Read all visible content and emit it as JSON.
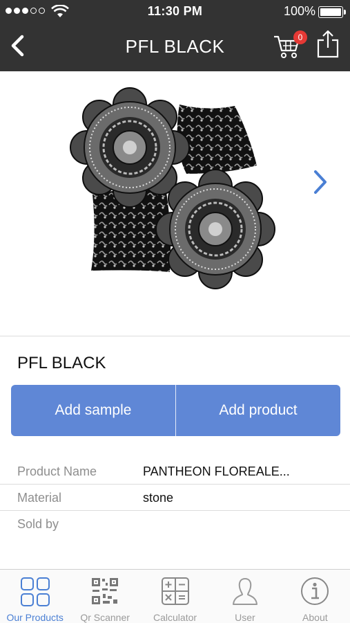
{
  "status_bar": {
    "time": "11:30 PM",
    "battery": "100%",
    "signal_bars_filled": 3,
    "signal_bars_total": 5
  },
  "nav": {
    "title": "PFL BLACK",
    "back_icon": "chevron-left-icon",
    "cart_icon": "cart-icon",
    "cart_count": "0",
    "share_icon": "share-icon"
  },
  "gallery": {
    "next_icon": "chevron-right-icon"
  },
  "product": {
    "name": "PFL BLACK",
    "add_sample_label": "Add sample",
    "add_product_label": "Add product"
  },
  "specs": [
    {
      "label": "Product Name",
      "value": "PANTHEON FLOREALE..."
    },
    {
      "label": "Material",
      "value": "stone"
    },
    {
      "label": "Sold by",
      "value": ""
    }
  ],
  "tabbar": [
    {
      "label": "Our Products",
      "icon": "grid-icon",
      "active": true
    },
    {
      "label": "Qr Scanner",
      "icon": "qr-code-icon",
      "active": false
    },
    {
      "label": "Calculator",
      "icon": "calculator-icon",
      "active": false
    },
    {
      "label": "User",
      "icon": "user-icon",
      "active": false
    },
    {
      "label": "About",
      "icon": "info-icon",
      "active": false
    }
  ],
  "colors": {
    "header": "#333333",
    "accent": "#5f87d6",
    "active_tab": "#4a7fd4",
    "badge": "#e53935"
  }
}
